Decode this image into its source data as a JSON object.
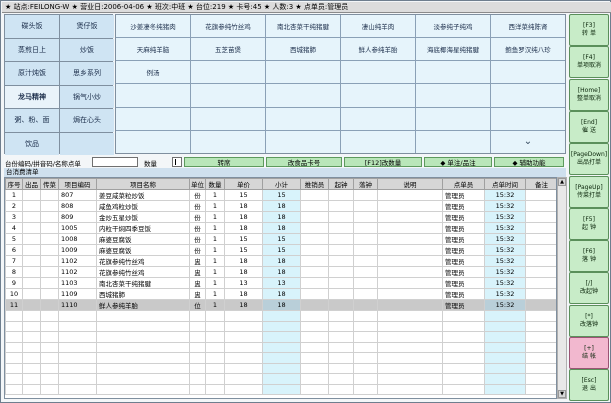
{
  "title": "★ 站点:FEILONG-W ★ 营业日:2006-04-06 ★ 班次:中班 ★ 台位:219 ★ 卡号:45 ★ 人数:3 ★ 点单员:管理员",
  "categories": [
    [
      "碟头饭",
      "煲仔饭"
    ],
    [
      "蒸煎日上",
      "炒饭"
    ],
    [
      "原汁炖饭",
      "思乡系列"
    ],
    [
      "龙马精神",
      "锅气小炒"
    ],
    [
      "粥、粉、面",
      "焗在心头"
    ],
    [
      "饮品",
      ""
    ]
  ],
  "dishes": [
    [
      "沙姜凄冬纯猪肉",
      "花旗参纯竹丝鸡",
      "南北杏菜干纯猪腱",
      "凄山纯羊肉",
      "淡参纯子纯鸡",
      "西洋菜纯陈肾"
    ],
    [
      "天麻纯羊脑",
      "五芝苗煲",
      "西城猪肺",
      "鲜人参纯羊胎",
      "海底椰海星纯猪腱",
      "鲍鱼罗汉纯八珍"
    ],
    [
      "例汤",
      "",
      "",
      "",
      "",
      ""
    ],
    [
      "",
      "",
      "",
      "",
      "",
      ""
    ],
    [
      "",
      "",
      "",
      "",
      "",
      ""
    ],
    [
      "",
      "",
      "",
      "",
      "",
      ""
    ]
  ],
  "scroll_down_glyph": "⌄",
  "query": {
    "label": "台份编码/拼音码/名称点单",
    "qty_label": "数量",
    "buttons": [
      "转席",
      "改食品卡号",
      "[F12]改数量",
      "◆ 单注/品注",
      "◆ 辅助功能"
    ]
  },
  "orders_label": "台消费清单",
  "scroll_up_glyph": "▲",
  "scroll_down_btn_glyph": "▼",
  "columns": [
    "序号",
    "出品",
    "传菜",
    "项目编码",
    "项目名称",
    "单位",
    "数量",
    "单价",
    "小计",
    "推销员",
    "起钟",
    "落钟",
    "说明",
    "点单员",
    "点单时间",
    "备注"
  ],
  "rows": [
    [
      "1",
      "",
      "",
      "807",
      "姜豆咸菜粒炒饭",
      "份",
      "1",
      "15",
      "15",
      "",
      "",
      "",
      "",
      "管理员",
      "15:32",
      ""
    ],
    [
      "2",
      "",
      "",
      "808",
      "咸鱼鸡粒炒饭",
      "份",
      "1",
      "18",
      "18",
      "",
      "",
      "",
      "",
      "管理员",
      "15:32",
      ""
    ],
    [
      "3",
      "",
      "",
      "809",
      "金炒五星炒饭",
      "份",
      "1",
      "18",
      "18",
      "",
      "",
      "",
      "",
      "管理员",
      "15:32",
      ""
    ],
    [
      "4",
      "",
      "",
      "1005",
      "内粒干焖四季豆饭",
      "份",
      "1",
      "18",
      "18",
      "",
      "",
      "",
      "",
      "管理员",
      "15:32",
      ""
    ],
    [
      "5",
      "",
      "",
      "1008",
      "麻婆豆腐饭",
      "份",
      "1",
      "15",
      "15",
      "",
      "",
      "",
      "",
      "管理员",
      "15:32",
      ""
    ],
    [
      "6",
      "",
      "",
      "1009",
      "麻婆豆腐饭",
      "份",
      "1",
      "15",
      "15",
      "",
      "",
      "",
      "",
      "管理员",
      "15:32",
      ""
    ],
    [
      "7",
      "",
      "",
      "1102",
      "花旗参纯竹丝鸡",
      "盅",
      "1",
      "18",
      "18",
      "",
      "",
      "",
      "",
      "管理员",
      "15:32",
      ""
    ],
    [
      "8",
      "",
      "",
      "1102",
      "花旗参纯竹丝鸡",
      "盅",
      "1",
      "18",
      "18",
      "",
      "",
      "",
      "",
      "管理员",
      "15:32",
      ""
    ],
    [
      "9",
      "",
      "",
      "1103",
      "南北杏菜干纯猪腱",
      "盅",
      "1",
      "13",
      "13",
      "",
      "",
      "",
      "",
      "管理员",
      "15:32",
      ""
    ],
    [
      "10",
      "",
      "",
      "1109",
      "西城猪肺",
      "盅",
      "1",
      "18",
      "18",
      "",
      "",
      "",
      "",
      "管理员",
      "15:32",
      ""
    ],
    [
      "11",
      "",
      "",
      "1110",
      "鲜人参纯羊胎",
      "位",
      "1",
      "18",
      "18",
      "",
      "",
      "",
      "",
      "管理员",
      "15:32",
      ""
    ]
  ],
  "selected_row": 10,
  "side_buttons": [
    {
      "l1": "[F3]",
      "l2": "转 单"
    },
    {
      "l1": "[F4]",
      "l2": "单项取消"
    },
    {
      "l1": "[Home]",
      "l2": "整单取消"
    },
    {
      "l1": "[End]",
      "l2": "催 送"
    },
    {
      "l1": "[PageDown]",
      "l2": "出品打单"
    },
    {
      "l1": "[PageUp]",
      "l2": "传菜打单"
    },
    {
      "l1": "[F5]",
      "l2": "起 钟"
    },
    {
      "l1": "[F6]",
      "l2": "落 钟"
    },
    {
      "l1": "[/]",
      "l2": "改起钟"
    },
    {
      "l1": "[*]",
      "l2": "改落钟"
    },
    {
      "l1": "[+]",
      "l2": "结 帐"
    },
    {
      "l1": "[Esc]",
      "l2": "退 出"
    }
  ],
  "accent_colors": {
    "button_green": "#c8ecc8",
    "checkout_pink": "#f2b8cf",
    "category_blue": "#cfe4f3",
    "dish_blue": "#e6f4fb"
  }
}
